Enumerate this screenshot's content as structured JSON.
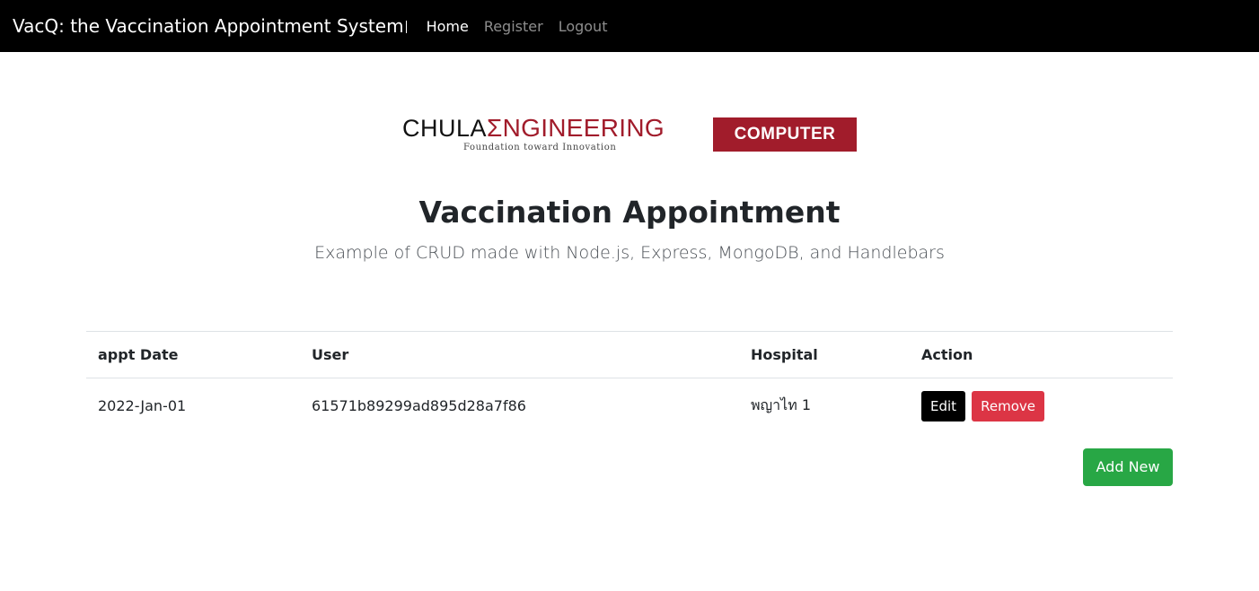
{
  "navbar": {
    "brand": "VacQ: the Vaccination Appointment System",
    "links": [
      {
        "label": "Home",
        "active": true
      },
      {
        "label": "Register",
        "active": false
      },
      {
        "label": "Logout",
        "active": false
      }
    ]
  },
  "logo": {
    "chula": "CHULA",
    "engineering": "ΣNGINEERING",
    "tagline": "Foundation toward Innovation",
    "computer": "COMPUTER"
  },
  "heading": {
    "title": "Vaccination Appointment",
    "subtitle": "Example of CRUD made with Node.js, Express, MongoDB, and Handlebars"
  },
  "table": {
    "headers": [
      "appt Date",
      "User",
      "Hospital",
      "Action"
    ],
    "rows": [
      {
        "apptDate": "2022-Jan-01",
        "user": "61571b89299ad895d28a7f86",
        "hospital": "พญาไท 1",
        "edit_label": "Edit",
        "remove_label": "Remove"
      }
    ]
  },
  "add_button": "Add New",
  "colors": {
    "navbar_bg": "#000000",
    "brand_red": "#a11c2b",
    "remove_red": "#dc3545",
    "add_green": "#28a745"
  }
}
